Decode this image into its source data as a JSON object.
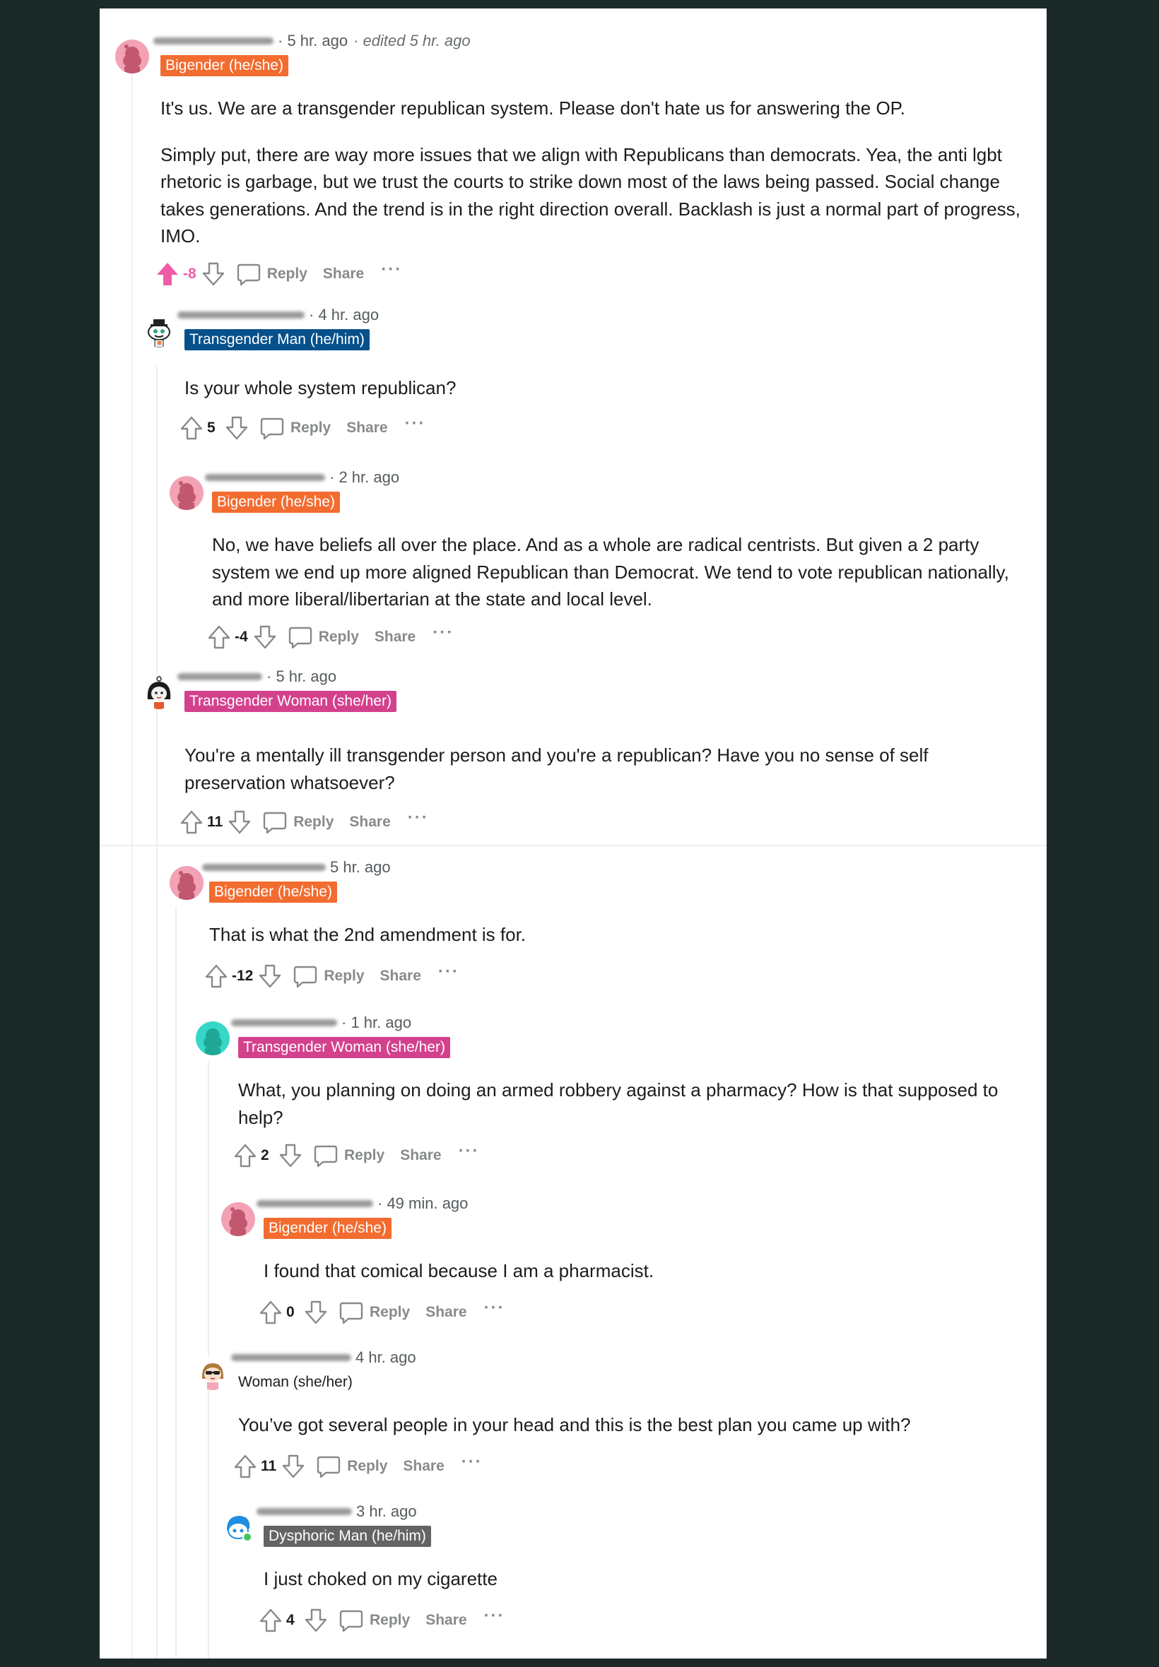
{
  "colors": {
    "bigender": "#f26c30",
    "transgender_man": "#06508b",
    "transgender_woman": "#d3418d",
    "dysphoric_man": "#646464",
    "upvoted": "#ef5da8",
    "page_background": "#1b2a29"
  },
  "action_labels": {
    "reply": "Reply",
    "share": "Share",
    "more": "···"
  },
  "comments": [
    {
      "avatar": "pink-snoo-avatar",
      "timestamp": "· 5 hr. ago",
      "edited": "· edited 5 hr. ago",
      "flair": "Bigender (he/she)",
      "body": [
        "It's us. We are a transgender republican system. Please don't hate us for answering the OP.",
        "Simply put, there are way more issues that we align with Republicans than democrats. Yea, the anti lgbt rhetoric is garbage, but we trust the courts to strike down most of the laws being passed. Social change takes generations. And the trend is in the right direction overall. Backlash is just a normal part of progress, IMO."
      ],
      "score": "-8",
      "upvoted": true
    },
    {
      "avatar": "snoo-with-hat-avatar",
      "timestamp": "· 4 hr. ago",
      "flair": "Transgender Man (he/him)",
      "body": [
        "Is your whole system republican?"
      ],
      "score": "5"
    },
    {
      "avatar": "pink-snoo-avatar",
      "timestamp": "· 2 hr. ago",
      "flair": "Bigender (he/she)",
      "body": [
        "No, we have beliefs all over the place. And as a whole are radical centrists. But given a 2 party system we end up more aligned Republican than Democrat. We tend to vote republican nationally, and more liberal/libertarian at the state and local level."
      ],
      "score": "-4"
    },
    {
      "avatar": "dark-hair-snoo-avatar",
      "timestamp": "· 5 hr. ago",
      "flair": "Transgender Woman (she/her)",
      "body": [
        "You're a mentally ill transgender person and you're a republican? Have you no sense of self preservation whatsoever?"
      ],
      "score": "11"
    },
    {
      "avatar": "pink-snoo-avatar",
      "timestamp": "5 hr. ago",
      "flair": "Bigender (he/she)",
      "body": [
        "That is what the 2nd amendment is for."
      ],
      "score": "-12"
    },
    {
      "avatar": "teal-snoo-avatar",
      "timestamp": "· 1 hr. ago",
      "flair": "Transgender Woman (she/her)",
      "body": [
        "What, you planning on doing an armed robbery against a pharmacy? How is that supposed to help?"
      ],
      "score": "2"
    },
    {
      "avatar": "pink-snoo-avatar",
      "timestamp": "· 49 min. ago",
      "flair": "Bigender (he/she)",
      "body": [
        "I found that comical because I am a pharmacist."
      ],
      "score": "0"
    },
    {
      "avatar": "sunglasses-snoo-avatar",
      "timestamp": "4 hr. ago",
      "flair": "Woman (she/her)",
      "body": [
        "You’ve got several people in your head and this is the best plan you came up with?"
      ],
      "score": "11"
    },
    {
      "avatar": "blue-snoo-avatar",
      "timestamp": "3 hr. ago",
      "flair": "Dysphoric Man (he/him)",
      "body": [
        "I just choked on my cigarette"
      ],
      "score": "4"
    }
  ]
}
